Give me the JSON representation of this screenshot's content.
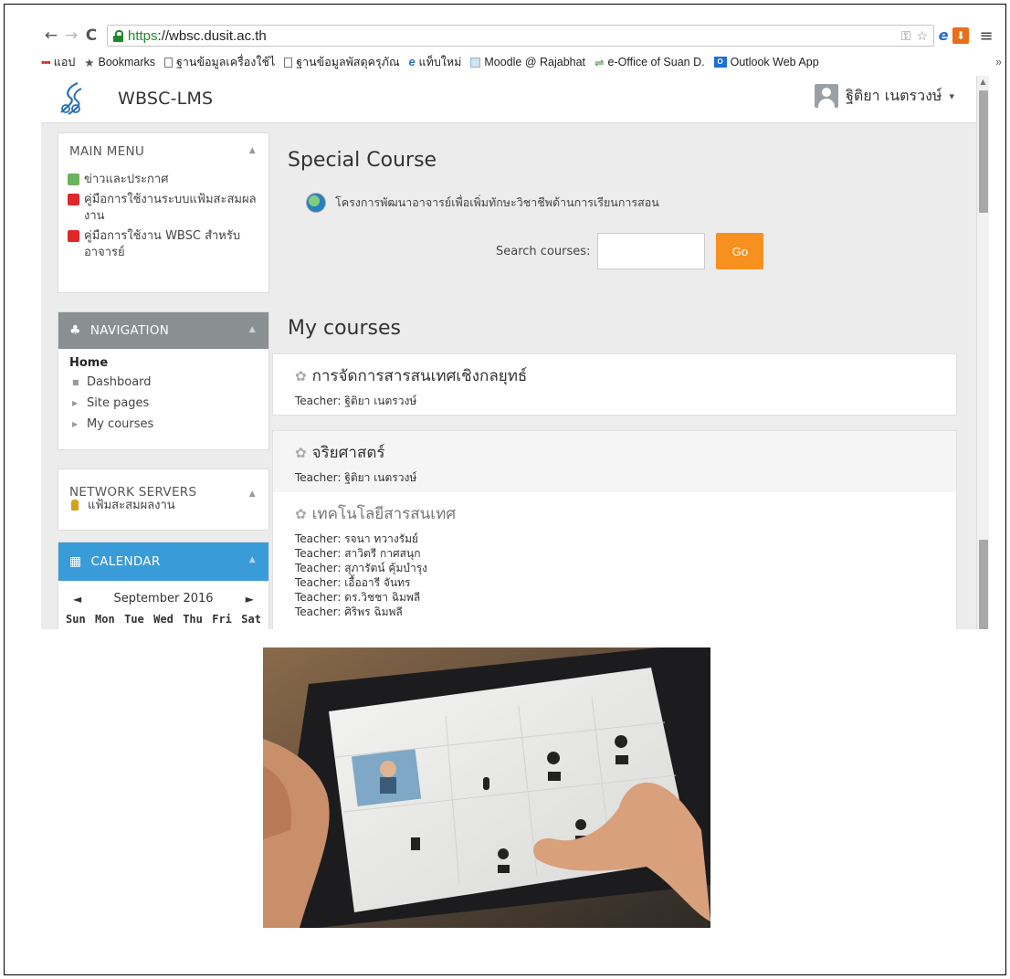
{
  "browser": {
    "url_proto": "https",
    "url_rest": "://wbsc.dusit.ac.th",
    "nav_back": "←",
    "nav_forward": "→",
    "nav_reload": "C",
    "menu": "≡",
    "url_icons": {
      "key": "⚿",
      "star": "☆"
    },
    "ext_ie": "e",
    "ext_dl": "⬇"
  },
  "bookmarks": [
    {
      "label": "แอป",
      "icon": "apps-icon"
    },
    {
      "label": "Bookmarks",
      "icon": "star-icon"
    },
    {
      "label": "ฐานข้อมูลเครื่องใช้ไ",
      "icon": "doc-icon"
    },
    {
      "label": "ฐานข้อมูลพัสดุครุภัณ",
      "icon": "doc-icon"
    },
    {
      "label": "แท็บใหม่",
      "icon": "ie-icon"
    },
    {
      "label": "Moodle @ Rajabhat",
      "icon": "moodle-icon"
    },
    {
      "label": "e-Office of Suan D.",
      "icon": "eoffice-icon"
    },
    {
      "label": "Outlook Web App",
      "icon": "outlook-icon"
    }
  ],
  "bookmarks_more": "»",
  "header": {
    "site_name": "WBSC-LMS",
    "user_name": "ฐิติยา เนตรวงษ์",
    "caret": "▾"
  },
  "main_menu": {
    "title": "MAIN MENU",
    "items": [
      {
        "label": "ข่าวและประกาศ"
      },
      {
        "label": "คู่มือการใช้งานระบบแฟ้มสะสมผลงาน"
      },
      {
        "label": "คู่มือการใช้งาน WBSC สำหรับอาจารย์"
      }
    ]
  },
  "navigation": {
    "title": "NAVIGATION",
    "home": "Home",
    "items": [
      "Dashboard",
      "Site pages",
      "My courses"
    ]
  },
  "network": {
    "title": "NETWORK SERVERS",
    "items": [
      "แฟ้มสะสมผลงาน"
    ]
  },
  "calendar": {
    "title": "CALENDAR",
    "month": "September 2016",
    "prev": "◄",
    "next": "►",
    "days": [
      "Sun",
      "Mon",
      "Tue",
      "Wed",
      "Thu",
      "Fri",
      "Sat"
    ]
  },
  "main": {
    "special_title": "Special Course",
    "special_item": "โครงการพัฒนาอาจารย์เพื่อเพิ่มทักษะวิชาชีพด้านการเรียนการสอน",
    "search_label": "Search courses:",
    "search_value": "",
    "go_label": "Go",
    "my_courses_title": "My courses"
  },
  "courses": [
    {
      "name": "การจัดการสารสนเทศเชิงกลยุทธ์",
      "teachers": [
        "Teacher: ฐิติยา เนตรวงษ์"
      ]
    },
    {
      "name": "จริยศาสตร์",
      "teachers": [
        "Teacher: ฐิติยา เนตรวงษ์"
      ]
    },
    {
      "name": "เทคโนโลยีสารสนเทศ",
      "teachers": [
        "Teacher: รจนา ทวางรัมย์",
        "Teacher: สาวิตรี กาศสนุก",
        "Teacher: สุภารัตน์ คุ้มบำรุง",
        "Teacher: เอื้ออารี จันทร",
        "Teacher: ดร.วิชชา ฉิมพลี",
        "Teacher: ศิริพร ฉิมพลี"
      ]
    }
  ],
  "colors": {
    "go_button": "#f7901e",
    "calendar_header": "#3a9bd9",
    "navigation_header": "#8a8f92",
    "secure_green": "#1f8a2d"
  }
}
